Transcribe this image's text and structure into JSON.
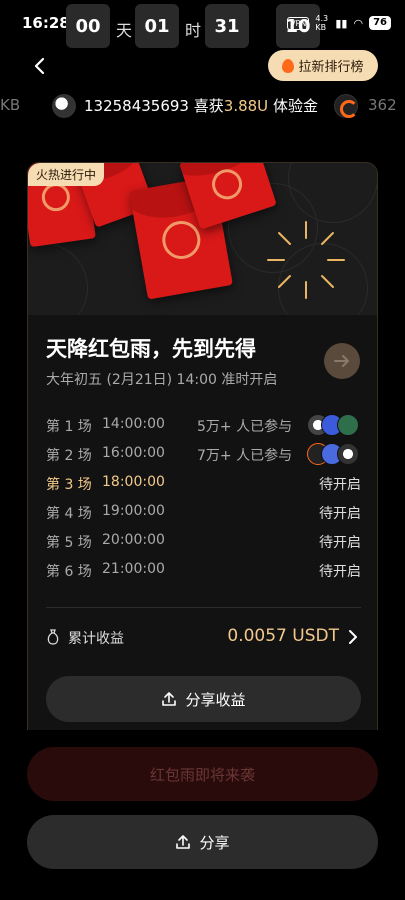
{
  "status_bar": {
    "time": "16:28",
    "countdown": {
      "days": "00",
      "day_unit": "天",
      "hours": "01",
      "hour_unit": "时",
      "minutes": "31",
      "minute_unit": "",
      "seconds": "10"
    },
    "net_tag": "VPN",
    "speed": "4.3 KB",
    "battery": "76"
  },
  "header": {
    "back_icon": "chevron-left-icon",
    "rank_button": "拉新排行榜"
  },
  "ticker": {
    "left_fragment": "KB",
    "phone": "13258435693",
    "verb": "喜获",
    "amount": "3.88U",
    "reward": "体验金",
    "right_fragment": "362"
  },
  "card": {
    "status_tag": "火热进行中",
    "title": "天降红包雨，先到先得",
    "subtitle": "大年初五 (2月21日) 14:00 准时开启",
    "sessions": [
      {
        "label": "第 1 场",
        "time": "14:00:00",
        "participants": "5万+ 人已参与",
        "status": "",
        "state": "done"
      },
      {
        "label": "第 2 场",
        "time": "16:00:00",
        "participants": "7万+ 人已参与",
        "status": "",
        "state": "done"
      },
      {
        "label": "第 3 场",
        "time": "18:00:00",
        "participants": "",
        "status": "待开启",
        "state": "active"
      },
      {
        "label": "第 4 场",
        "time": "19:00:00",
        "participants": "",
        "status": "待开启",
        "state": "pending"
      },
      {
        "label": "第 5 场",
        "time": "20:00:00",
        "participants": "",
        "status": "待开启",
        "state": "pending"
      },
      {
        "label": "第 6 场",
        "time": "21:00:00",
        "participants": "",
        "status": "待开启",
        "state": "pending"
      }
    ],
    "earnings_label": "累计收益",
    "earnings_value": "0.0057 USDT",
    "share_earnings_button": "分享收益"
  },
  "footer": {
    "rain_button": "红包雨即将来袭",
    "share_button": "分享"
  },
  "colors": {
    "accent_gold": "#f3c98b",
    "envelope_red": "#d91818",
    "rank_bg": "#f6dcb3"
  }
}
